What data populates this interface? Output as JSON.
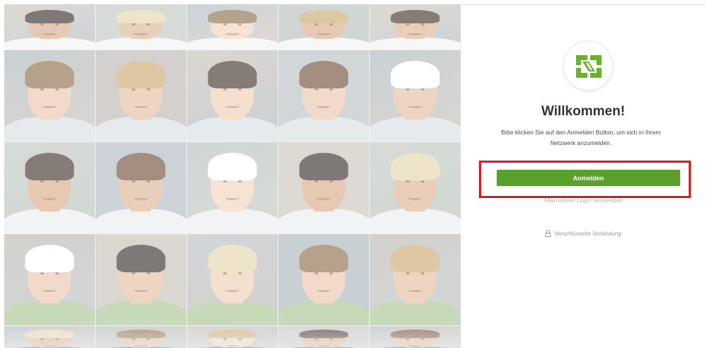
{
  "login": {
    "title": "Willkommen!",
    "subtitle": "Bitte klicken Sie auf den Anmelden Button, um sich in Ihrem Netzwerk anzumelden.",
    "button_label": "Anmelden",
    "alternative_login_label": "Alternativen Login verwenden",
    "secure_connection_label": "Verschlüsselte Verbindung",
    "lock_icon": "lock-icon",
    "logo_icon": "company-logo-icon"
  },
  "colors": {
    "primary_button": "#5aa02c",
    "logo_green": "#6ab42a",
    "highlight_box": "#e3141b",
    "title": "#333333",
    "muted_text": "#b0b0b0"
  }
}
